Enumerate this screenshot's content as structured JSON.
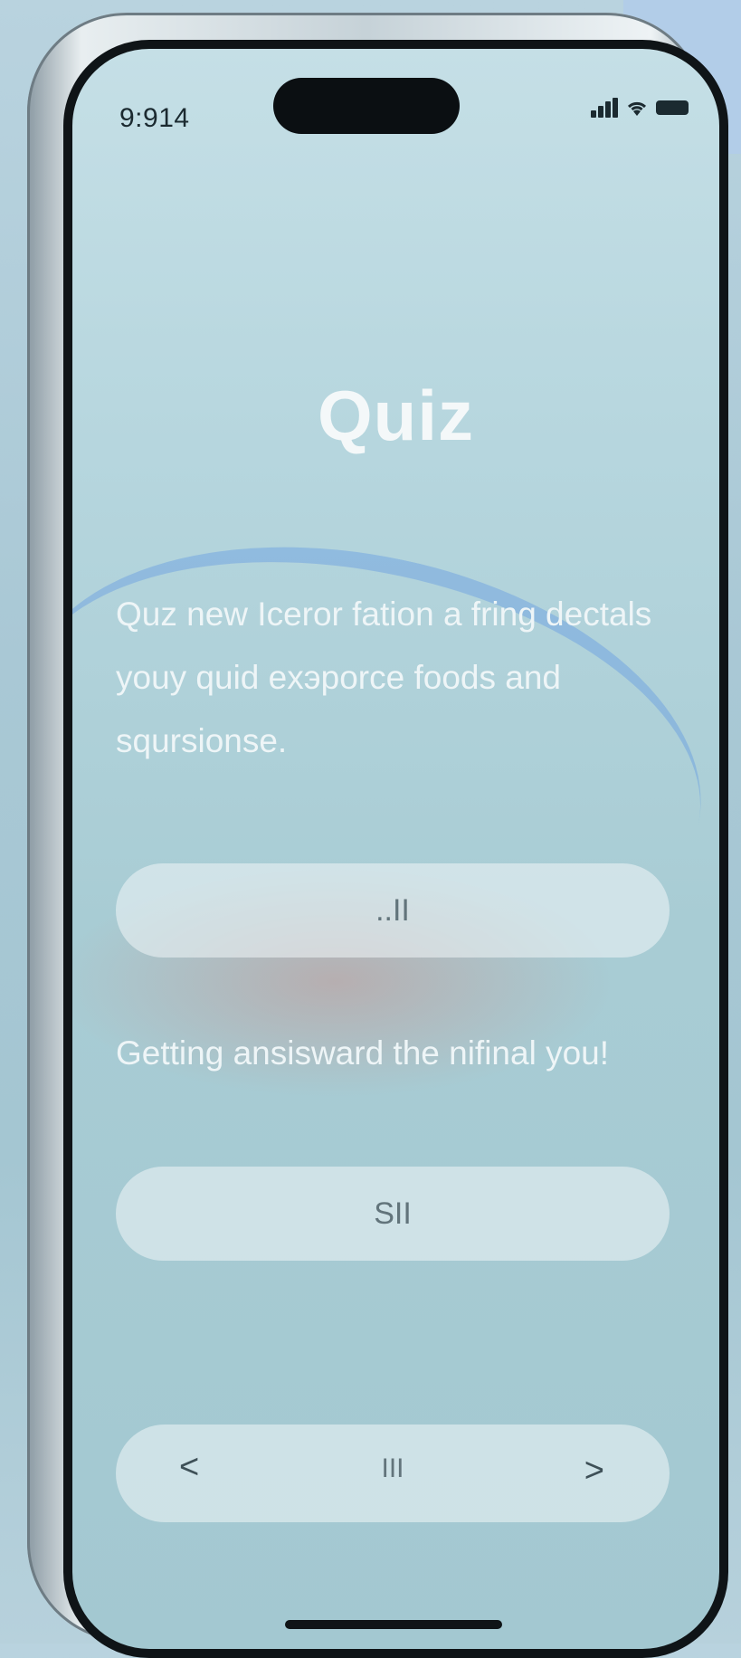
{
  "status_bar": {
    "time": "9:914"
  },
  "screen": {
    "title": "Quiz",
    "description": "Quz new Iceror fation a fring dectals youy quid exэporce foods and sqursionse.",
    "answer_button_1": "..II",
    "prompt": "Getting ansisward the nifinal you!",
    "answer_button_2": "SII",
    "nav": {
      "prev": "<",
      "middle": "III",
      "next": ">"
    }
  },
  "colors": {
    "accent_text": "#eef5f7",
    "pill_bg": "#f0f6f8"
  },
  "icons": [
    "signal-icon",
    "wifi-icon",
    "battery-icon"
  ]
}
